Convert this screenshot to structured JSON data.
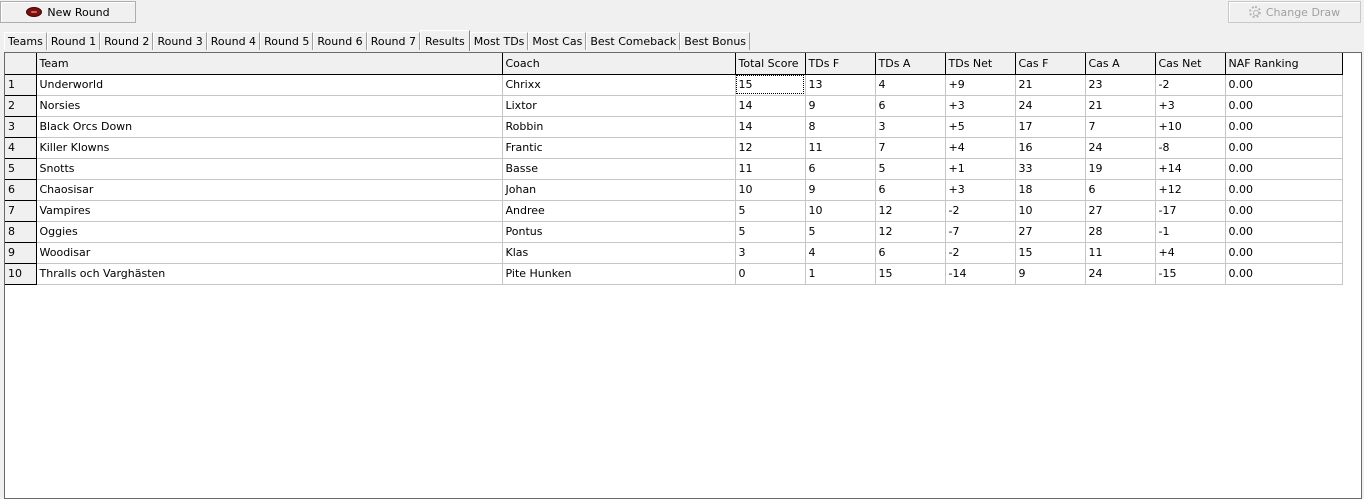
{
  "toolbar": {
    "new_round_label": "New Round",
    "change_draw_label": "Change Draw",
    "new_round_icon": "football-icon",
    "change_draw_icon": "gear-icon"
  },
  "tabs": [
    {
      "label": "Teams",
      "active": false
    },
    {
      "label": "Round 1",
      "active": false
    },
    {
      "label": "Round 2",
      "active": false
    },
    {
      "label": "Round 3",
      "active": false
    },
    {
      "label": "Round 4",
      "active": false
    },
    {
      "label": "Round 5",
      "active": false
    },
    {
      "label": "Round 6",
      "active": false
    },
    {
      "label": "Round 7",
      "active": false
    },
    {
      "label": "Results",
      "active": true
    },
    {
      "label": "Most TDs",
      "active": false
    },
    {
      "label": "Most Cas",
      "active": false
    },
    {
      "label": "Best Comeback",
      "active": false
    },
    {
      "label": "Best Bonus",
      "active": false
    }
  ],
  "results": {
    "columns": [
      "Team",
      "Coach",
      "Total Score",
      "TDs F",
      "TDs A",
      "TDs Net",
      "Cas F",
      "Cas A",
      "Cas Net",
      "NAF Ranking"
    ],
    "rows": [
      [
        "1",
        "Underworld",
        "Chrixx",
        "15",
        "13",
        "4",
        "+9",
        "21",
        "23",
        "-2",
        "0.00"
      ],
      [
        "2",
        "Norsies",
        "Lixtor",
        "14",
        "9",
        "6",
        "+3",
        "24",
        "21",
        "+3",
        "0.00"
      ],
      [
        "3",
        "Black Orcs Down",
        "Robbin",
        "14",
        "8",
        "3",
        "+5",
        "17",
        "7",
        "+10",
        "0.00"
      ],
      [
        "4",
        "Killer Klowns",
        "Frantic",
        "12",
        "11",
        "7",
        "+4",
        "16",
        "24",
        "-8",
        "0.00"
      ],
      [
        "5",
        "Snotts",
        "Basse",
        "11",
        "6",
        "5",
        "+1",
        "33",
        "19",
        "+14",
        "0.00"
      ],
      [
        "6",
        "Chaosisar",
        "Johan",
        "10",
        "9",
        "6",
        "+3",
        "18",
        "6",
        "+12",
        "0.00"
      ],
      [
        "7",
        "Vampires",
        "Andree",
        "5",
        "10",
        "12",
        "-2",
        "10",
        "27",
        "-17",
        "0.00"
      ],
      [
        "8",
        "Oggies",
        "Pontus",
        "5",
        "5",
        "12",
        "-7",
        "27",
        "28",
        "-1",
        "0.00"
      ],
      [
        "9",
        "Woodisar",
        "Klas",
        "3",
        "4",
        "6",
        "-2",
        "15",
        "11",
        "+4",
        "0.00"
      ],
      [
        "10",
        "Thralls och Varghästen",
        "Pite Hunken",
        "0",
        "1",
        "15",
        "-14",
        "9",
        "24",
        "-15",
        "0.00"
      ]
    ]
  }
}
